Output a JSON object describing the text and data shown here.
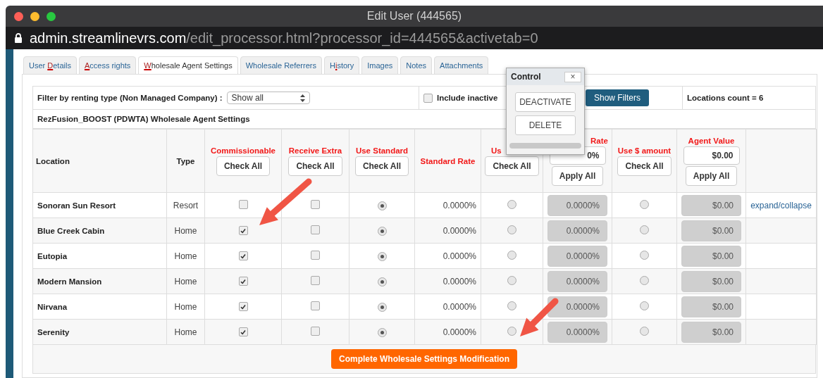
{
  "window": {
    "title": "Edit User (444565)",
    "url_host": "admin.streamlinevrs.com",
    "url_path": "/edit_processor.html?processor_id=444565&activetab=0"
  },
  "tabs": [
    {
      "parts": [
        {
          "text": "User ",
          "underlined": false
        },
        {
          "text": "D",
          "underlined": true
        },
        {
          "text": "etails",
          "underlined": false
        }
      ],
      "selected": false
    },
    {
      "parts": [
        {
          "text": "A",
          "underlined": true
        },
        {
          "text": "ccess rights",
          "underlined": false
        }
      ],
      "selected": false
    },
    {
      "parts": [
        {
          "text": "W",
          "underlined": true
        },
        {
          "text": "holesale Agent Settings",
          "underlined": false
        }
      ],
      "selected": true
    },
    {
      "parts": [
        {
          "text": "Wholesale Referrers",
          "underlined": false
        }
      ],
      "selected": false
    },
    {
      "parts": [
        {
          "text": "H",
          "underlined": false
        },
        {
          "text": "i",
          "underlined": true
        },
        {
          "text": "story",
          "underlined": false
        }
      ],
      "selected": false
    },
    {
      "parts": [
        {
          "text": "Images",
          "underlined": false
        }
      ],
      "selected": false
    },
    {
      "parts": [
        {
          "text": "Notes",
          "underlined": false
        }
      ],
      "selected": false
    },
    {
      "parts": [
        {
          "text": "Attachments",
          "underlined": false
        }
      ],
      "selected": false
    }
  ],
  "filter": {
    "label": "Filter by renting type (Non Managed Company) :",
    "select": "Show all",
    "include_inactive": {
      "label": "Include inactive",
      "checked": false
    },
    "show_filters": "Show Filters",
    "count": "Locations count = 6"
  },
  "section_title": "RezFusion_BOOST (PDWTA) Wholesale Agent Settings",
  "columns": [
    {
      "kind": "plain",
      "label": "Location"
    },
    {
      "kind": "plain",
      "label": "Type"
    },
    {
      "kind": "red",
      "label": "Commissionable",
      "button": "Check All"
    },
    {
      "kind": "red",
      "label": "Receive Extra",
      "button": "Check All"
    },
    {
      "kind": "red",
      "label": "Use Standard",
      "button": "Check All"
    },
    {
      "kind": "red",
      "label": "Standard Rate"
    },
    {
      "kind": "red",
      "label": "Us",
      "clipped_right": true,
      "button": "Check All"
    },
    {
      "kind": "red",
      "label": "Rate",
      "clipped_left": true,
      "input": "0%",
      "button": "Apply All"
    },
    {
      "kind": "red",
      "label": "Use $ amount",
      "button": "Check All"
    },
    {
      "kind": "red",
      "label": "Agent Value",
      "input": "$0.00",
      "button": "Apply All"
    }
  ],
  "rows": [
    {
      "cells": [
        {
          "kind": "name",
          "text": "Sonoran Sun Resort"
        },
        {
          "kind": "text",
          "text": "Resort"
        },
        {
          "kind": "checkbox",
          "checked": false
        },
        {
          "kind": "checkbox",
          "checked": false
        },
        {
          "kind": "radio",
          "selected": true
        },
        {
          "kind": "rate",
          "text": "0.0000%"
        },
        {
          "kind": "radio",
          "selected": false
        },
        {
          "kind": "input",
          "value": "0.0000%",
          "disabled": true
        },
        {
          "kind": "radio",
          "selected": false
        },
        {
          "kind": "input",
          "value": "$0.00",
          "disabled": true
        },
        {
          "kind": "link",
          "text": "expand/collapse"
        }
      ]
    },
    {
      "cells": [
        {
          "kind": "name",
          "text": "Blue Creek Cabin"
        },
        {
          "kind": "text",
          "text": "Home"
        },
        {
          "kind": "checkbox",
          "checked": true
        },
        {
          "kind": "checkbox",
          "checked": false
        },
        {
          "kind": "radio",
          "selected": true
        },
        {
          "kind": "rate",
          "text": "0.0000%"
        },
        {
          "kind": "radio",
          "selected": false
        },
        {
          "kind": "input",
          "value": "0.0000%",
          "disabled": true
        },
        {
          "kind": "radio",
          "selected": false
        },
        {
          "kind": "input",
          "value": "$0.00",
          "disabled": true
        },
        {
          "kind": "blank"
        }
      ]
    },
    {
      "cells": [
        {
          "kind": "name",
          "text": "Eutopia"
        },
        {
          "kind": "text",
          "text": "Home"
        },
        {
          "kind": "checkbox",
          "checked": true
        },
        {
          "kind": "checkbox",
          "checked": false
        },
        {
          "kind": "radio",
          "selected": true
        },
        {
          "kind": "rate",
          "text": "0.0000%"
        },
        {
          "kind": "radio",
          "selected": false
        },
        {
          "kind": "input",
          "value": "0.0000%",
          "disabled": true
        },
        {
          "kind": "radio",
          "selected": false
        },
        {
          "kind": "input",
          "value": "$0.00",
          "disabled": true
        },
        {
          "kind": "blank"
        }
      ]
    },
    {
      "cells": [
        {
          "kind": "name",
          "text": "Modern Mansion"
        },
        {
          "kind": "text",
          "text": "Home"
        },
        {
          "kind": "checkbox",
          "checked": true
        },
        {
          "kind": "checkbox",
          "checked": false
        },
        {
          "kind": "radio",
          "selected": true
        },
        {
          "kind": "rate",
          "text": "0.0000%"
        },
        {
          "kind": "radio",
          "selected": false
        },
        {
          "kind": "input",
          "value": "0.0000%",
          "disabled": true
        },
        {
          "kind": "radio",
          "selected": false
        },
        {
          "kind": "input",
          "value": "$0.00",
          "disabled": true
        },
        {
          "kind": "blank"
        }
      ]
    },
    {
      "cells": [
        {
          "kind": "name",
          "text": "Nirvana"
        },
        {
          "kind": "text",
          "text": "Home"
        },
        {
          "kind": "checkbox",
          "checked": true
        },
        {
          "kind": "checkbox",
          "checked": false
        },
        {
          "kind": "radio",
          "selected": true
        },
        {
          "kind": "rate",
          "text": "0.0000%"
        },
        {
          "kind": "radio",
          "selected": false
        },
        {
          "kind": "input",
          "value": "0.0000%",
          "disabled": true
        },
        {
          "kind": "radio",
          "selected": false
        },
        {
          "kind": "input",
          "value": "$0.00",
          "disabled": true
        },
        {
          "kind": "blank"
        }
      ]
    },
    {
      "cells": [
        {
          "kind": "name",
          "text": "Serenity"
        },
        {
          "kind": "text",
          "text": "Home"
        },
        {
          "kind": "checkbox",
          "checked": true
        },
        {
          "kind": "checkbox",
          "checked": false
        },
        {
          "kind": "radio",
          "selected": true
        },
        {
          "kind": "rate",
          "text": "0.0000%"
        },
        {
          "kind": "radio",
          "selected": false
        },
        {
          "kind": "input",
          "value": "0.0000%",
          "disabled": true
        },
        {
          "kind": "radio",
          "selected": false
        },
        {
          "kind": "input",
          "value": "$0.00",
          "disabled": true
        },
        {
          "kind": "blank"
        }
      ]
    }
  ],
  "submit": "Complete Wholesale Settings Modification",
  "popup": {
    "title": "Control",
    "close": "×",
    "buttons": [
      "DEACTIVATE",
      "DELETE"
    ]
  }
}
